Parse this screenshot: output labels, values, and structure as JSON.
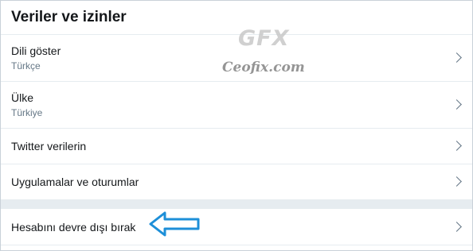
{
  "header": {
    "title": "Veriler ve izinler"
  },
  "rows": [
    {
      "label": "Dili göster",
      "sub": "Türkçe"
    },
    {
      "label": "Ülke",
      "sub": "Türkiye"
    },
    {
      "label": "Twitter verilerin"
    },
    {
      "label": "Uygulamalar ve oturumlar"
    },
    {
      "label": "Hesabını devre dışı bırak"
    }
  ],
  "watermark": {
    "brand": "GFX",
    "site": "Ceofix.com"
  },
  "icons": {
    "row_chevron": "chevron-right-icon",
    "annotation": "arrow-left-icon"
  },
  "colors": {
    "annotation_arrow": "#1d8fd8",
    "text_primary": "#14171a",
    "text_secondary": "#657786"
  }
}
